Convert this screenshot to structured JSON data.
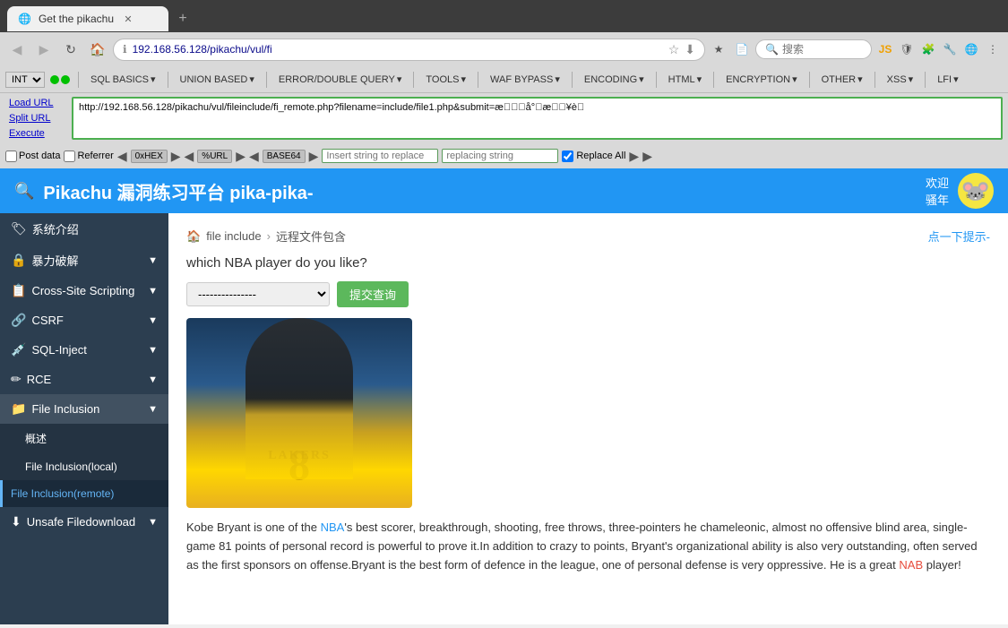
{
  "browser": {
    "tab": {
      "title": "Get the pikachu",
      "favicon": "🔵"
    },
    "address": "http://192.168.56.128/pikachu/vul/fileinclude/fi_remote.php?filename=include/file1.php&submit=æ\u0000\u0000\u0000å°\u0000æ\u0000\u0000¥è\u0000",
    "address_short": "192.168.56.128/pikachu/vul/fi",
    "search_placeholder": "搜索"
  },
  "toolbar": {
    "int_label": "INT",
    "items": [
      "SQL BASICS",
      "UNION BASED",
      "ERROR/DOUBLE QUERY",
      "TOOLS",
      "WAF BYPASS",
      "ENCODING",
      "HTML",
      "ENCRYPTION",
      "OTHER",
      "XSS",
      "LFI"
    ],
    "load_url": "Load URL",
    "split_url": "Split URL",
    "execute": "Execute"
  },
  "encoding_bar": {
    "post_data": "Post data",
    "referrer": "Referrer",
    "hex_label": "0xHEX",
    "percent_label": "%URL",
    "base64_label": "BASE64",
    "insert_string_placeholder": "Insert string to replace",
    "replacing_string_placeholder": "replacing string",
    "replace_all": "Replace All",
    "checkbox_replace_all": true
  },
  "app": {
    "title": "Pikachu 漏洞练习平台 pika-pika-",
    "welcome": "欢迎",
    "user": "骚年"
  },
  "breadcrumb": {
    "home": "file include",
    "separator": "›",
    "current": "远程文件包含",
    "hint": "点一下提示-"
  },
  "main_content": {
    "question": "which NBA player do you like?",
    "select_default": "---------------",
    "submit_btn": "提交查询",
    "player_name": "Kobe Bryant",
    "description": "Kobe Bryant is one of the NBA's best scorer, breakthrough, shooting, free throws, three-pointers he chameleonic, almost no offensive blind area, single-game 81 points of personal record is powerful to prove it.In addition to crazy to points, Bryant's organizational ability is also very outstanding, often served as the first sponsors on offense.Bryant is the best form of defence in the league, one of personal defense is very oppressive. He is a great NAB player!"
  },
  "sidebar": {
    "items": [
      {
        "id": "sys-intro",
        "icon": "🏷",
        "label": "系统介绍",
        "has_arrow": false
      },
      {
        "id": "brute-force",
        "icon": "🔒",
        "label": "暴力破解",
        "has_arrow": true
      },
      {
        "id": "xss",
        "icon": "📋",
        "label": "Cross-Site Scripting",
        "has_arrow": true
      },
      {
        "id": "csrf",
        "icon": "🔗",
        "label": "CSRF",
        "has_arrow": true
      },
      {
        "id": "sql-inject",
        "icon": "💉",
        "label": "SQL-Inject",
        "has_arrow": true
      },
      {
        "id": "rce",
        "icon": "✏",
        "label": "RCE",
        "has_arrow": true
      },
      {
        "id": "file-inclusion",
        "icon": "📁",
        "label": "File Inclusion",
        "has_arrow": true,
        "active": true
      },
      {
        "id": "unsafe-filedownload",
        "icon": "⬇",
        "label": "Unsafe Filedownload",
        "has_arrow": true
      }
    ],
    "sub_items": [
      {
        "id": "overview",
        "label": "概述"
      },
      {
        "id": "local",
        "label": "File Inclusion(local)"
      },
      {
        "id": "remote",
        "label": "File Inclusion(remote)",
        "active": true
      }
    ]
  }
}
